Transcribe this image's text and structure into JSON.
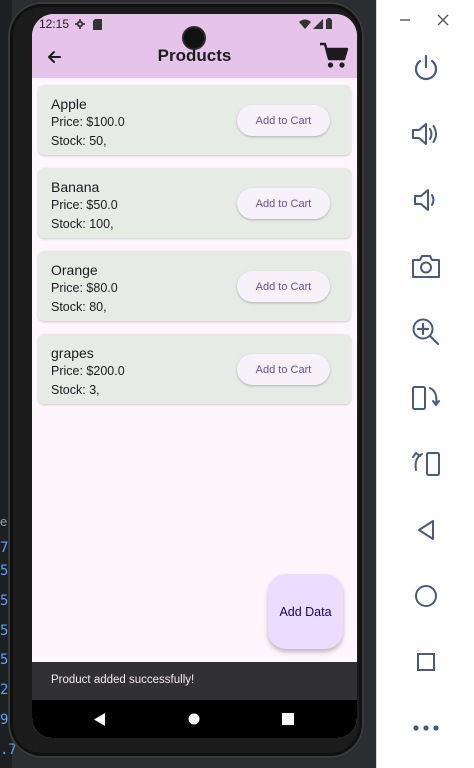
{
  "status_bar": {
    "time": "12:15"
  },
  "app_bar": {
    "title": "Products"
  },
  "products": [
    {
      "name": "Apple",
      "price": "Price: $100.0",
      "stock": "Stock: 50,",
      "button": "Add to Cart"
    },
    {
      "name": "Banana",
      "price": "Price: $50.0",
      "stock": "Stock: 100,",
      "button": "Add to Cart"
    },
    {
      "name": "Orange",
      "price": "Price: $80.0",
      "stock": "Stock: 80,",
      "button": "Add to Cart"
    },
    {
      "name": "grapes",
      "price": "Price: $200.0",
      "stock": "Stock: 3,",
      "button": "Add to Cart"
    }
  ],
  "fab": {
    "label": "Add Data"
  },
  "snackbar": {
    "message": "Product added successfully!"
  },
  "ide": {
    "letter": "e"
  },
  "colors": {
    "app_bar": "#e6c4e9",
    "card": "#e6ebe6",
    "button_text": "#6750a4",
    "fab": "#eaddff",
    "snackbar": "#313033",
    "background": "#fdf6fd"
  },
  "icons": {
    "back": "arrow-left-icon",
    "cart": "shopping-cart-icon",
    "nav": [
      "back-triangle-icon",
      "home-circle-icon",
      "recents-square-icon"
    ],
    "emulator_controls": [
      "power-icon",
      "volume-up-icon",
      "volume-down-icon",
      "camera-icon",
      "zoom-in-icon",
      "rotate-left-icon",
      "rotate-right-icon",
      "back-icon",
      "home-icon",
      "overview-icon",
      "more-icon"
    ]
  }
}
